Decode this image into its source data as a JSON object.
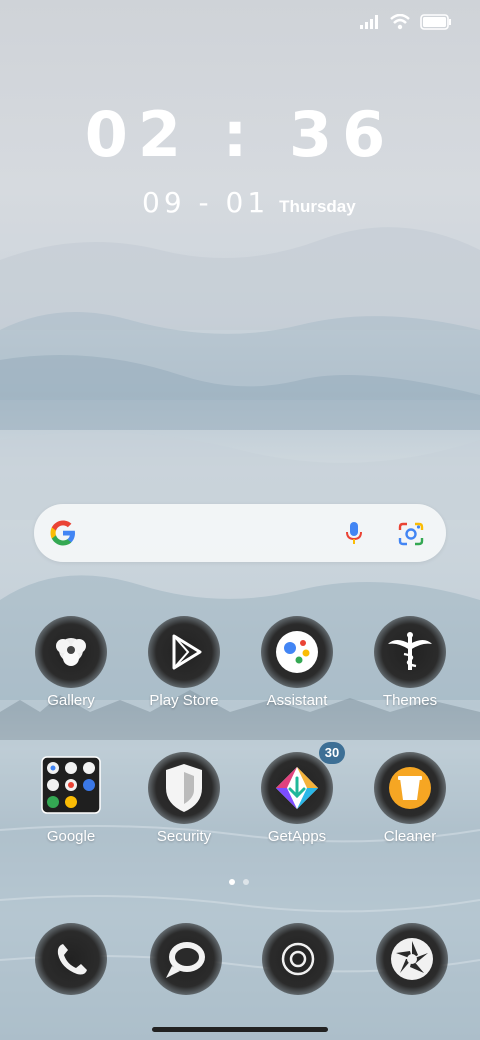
{
  "clock": {
    "time": "02 : 36",
    "date": "09 - 01",
    "weekday": "Thursday"
  },
  "status": {
    "signal_icon": "signal-icon",
    "wifi_icon": "wifi-icon",
    "battery_icon": "battery-icon"
  },
  "search": {
    "logo": "google-logo-icon",
    "mic": "mic-icon",
    "lens": "lens-icon"
  },
  "apps_row1": [
    {
      "label": "Gallery",
      "icon": "gallery-icon"
    },
    {
      "label": "Play Store",
      "icon": "play-store-icon"
    },
    {
      "label": "Assistant",
      "icon": "assistant-icon"
    },
    {
      "label": "Themes",
      "icon": "themes-icon"
    }
  ],
  "apps_row2": [
    {
      "label": "Google",
      "icon": "google-folder-icon"
    },
    {
      "label": "Security",
      "icon": "security-icon"
    },
    {
      "label": "GetApps",
      "icon": "getapps-icon",
      "badge": "30"
    },
    {
      "label": "Cleaner",
      "icon": "cleaner-icon"
    }
  ],
  "dock": [
    {
      "icon": "phone-icon"
    },
    {
      "icon": "messaging-icon"
    },
    {
      "icon": "chrome-icon"
    },
    {
      "icon": "camera-icon"
    }
  ],
  "page_indicator": {
    "pages": 2,
    "current": 1
  }
}
